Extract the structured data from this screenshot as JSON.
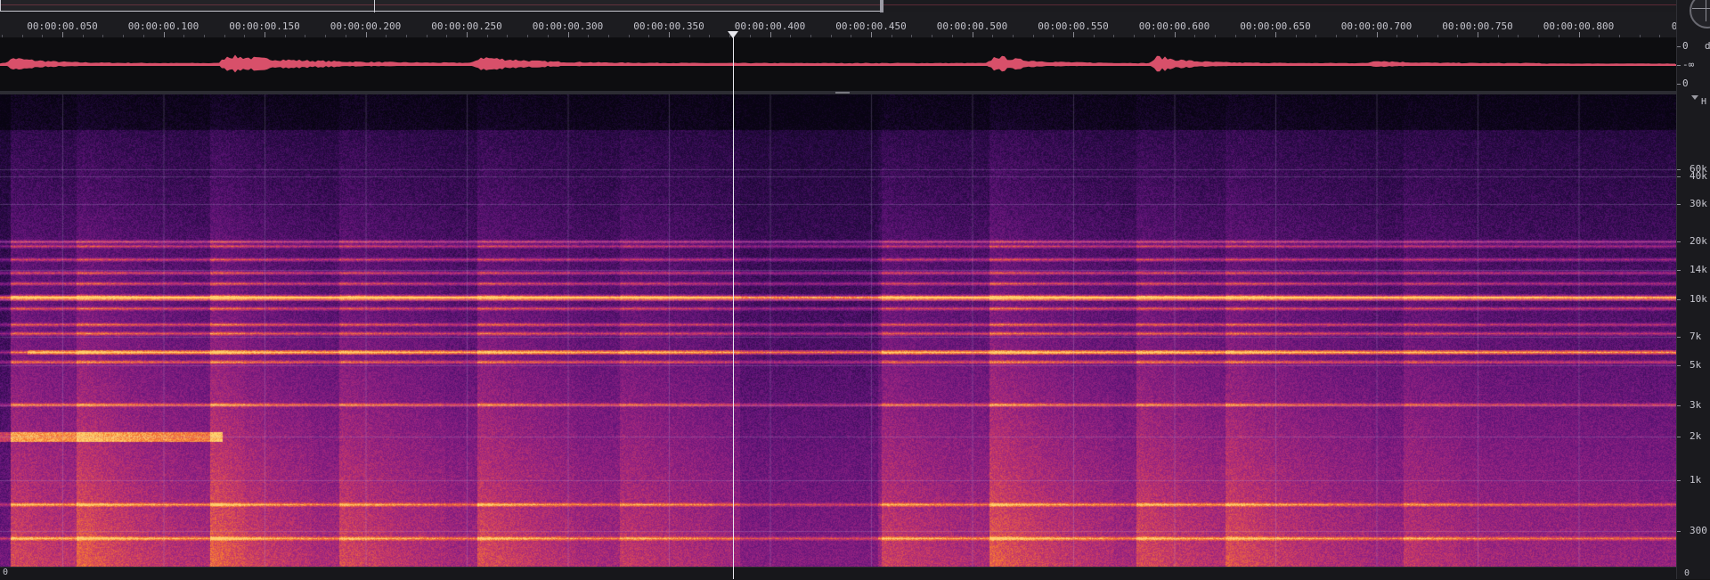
{
  "timeline": {
    "labels": [
      "00:00:00.050",
      "00:00:00.100",
      "00:00:00.150",
      "00:00:00.200",
      "00:00:00.250",
      "00:00:00.300",
      "00:00:00.350",
      "00:00:00.400",
      "00:00:00.450",
      "00:00:00.500",
      "00:00:00.550",
      "00:00:00.600",
      "00:00:00.650",
      "00:00:00.700",
      "00:00:00.750",
      "00:00:00.800",
      "00:0"
    ],
    "bottom_labels": [
      "0",
      "0"
    ]
  },
  "amplitude_scale": {
    "unit": "d",
    "labels": [
      "0",
      "-∞",
      "0"
    ]
  },
  "frequency_scale": {
    "unit": "H",
    "labels": [
      "60k",
      "40k",
      "30k",
      "20k",
      "14k",
      "10k",
      "7k",
      "5k",
      "3k",
      "2k",
      "1k",
      "300"
    ]
  },
  "playhead": {
    "time": "00:00:00.376"
  },
  "colors": {
    "waveform": "#d8506a",
    "playhead": "#e8e8ee",
    "spectrogram_low": "#0b0612",
    "spectrogram_mid": "#7a1f8a",
    "spectrogram_high": "#ff9a3c"
  },
  "icons": {
    "corner": "crosshair-knob-icon",
    "scroll": "scroll-up-icon"
  }
}
